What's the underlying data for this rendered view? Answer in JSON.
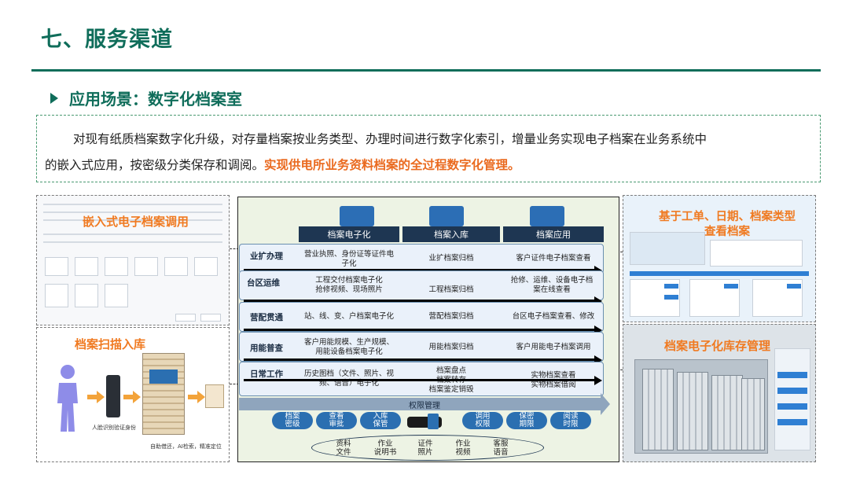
{
  "header": {
    "title": "七、服务渠道",
    "subtitle": "应用场景：数字化档案室"
  },
  "description": {
    "line1": "对现有纸质档案数字化升级，对存量档案按业务类型、办理时间进行数字化索引，增量业务实现电子档案在业务系统中",
    "line2_plain": "的嵌入式应用，按密级分类保存和调阅。",
    "line2_highlight": "实现供电所业务资料档案的全过程数字化管理。"
  },
  "panels": {
    "embedded": "嵌入式电子档案调用",
    "scan": "档案扫描入库",
    "scan_caption": "人脸识别验证身份",
    "scan_caption2": "自助借还，AI检索，精准定位",
    "query": "基于工单、日期、档案类型查看档案",
    "storage": "档案电子化库存管理"
  },
  "diagram": {
    "columns": [
      "档案电子化",
      "档案入库",
      "档案应用"
    ],
    "rows": [
      {
        "label": "业扩办理",
        "cells": [
          "营业执照、身份证等证件电子化",
          "业扩档案归档",
          "客户证件电子档案查看"
        ]
      },
      {
        "label": "台区运维",
        "cells": [
          "工程交付档案电子化\n抢修视频、现场照片",
          "工程档案归档",
          "抢修、运维、设备电子档案在线查看"
        ]
      },
      {
        "label": "营配贯通",
        "cells": [
          "站、线、变、户档案电子化",
          "营配档案归档",
          "台区电子档案查看、修改"
        ]
      },
      {
        "label": "用能普查",
        "cells": [
          "客户用能规模、生产规模、用能设备档案电子化",
          "用能档案归档",
          "客户用能电子档案调用"
        ]
      },
      {
        "label": "日常工作",
        "cells": [
          "历史图档（文件、照片、视频、语音）电子化",
          "档案盘点\n档案转存\n档案鉴定销毁",
          "实物档案查看\n实物档案借阅"
        ]
      }
    ],
    "permission_label": "权限管理",
    "permission_buttons": [
      "档案\n密级",
      "查看\n审批",
      "入库\n保管",
      "调用\n权限",
      "保密\n期限",
      "阅读\n时限"
    ],
    "materials": [
      "资料\n文件",
      "作业\n说明书",
      "证件\n照片",
      "作业\n视频",
      "客服\n语音"
    ]
  }
}
